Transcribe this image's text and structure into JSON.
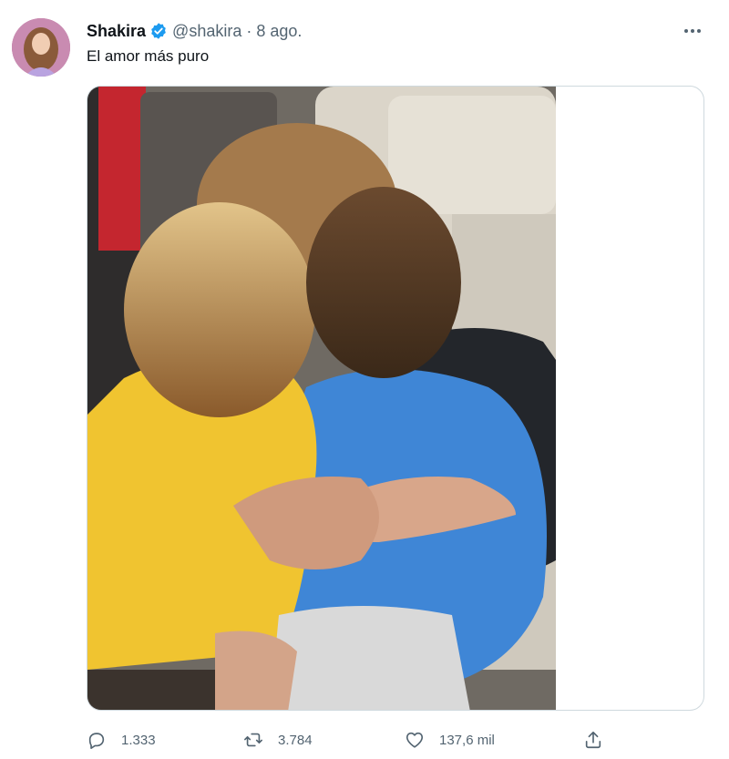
{
  "tweet": {
    "author": {
      "display_name": "Shakira",
      "handle": "@shakira",
      "verified": true,
      "avatar_icon": "profile-photo"
    },
    "time": "8 ago.",
    "separator": "·",
    "text": "El amor más puro",
    "media": {
      "kind": "photo"
    },
    "actions": {
      "reply": {
        "icon": "reply-icon",
        "count": "1.333"
      },
      "retweet": {
        "icon": "retweet-icon",
        "count": "3.784"
      },
      "like": {
        "icon": "heart-icon",
        "count": "137,6 mil"
      },
      "share": {
        "icon": "share-icon"
      }
    }
  },
  "colors": {
    "text": "#0f1419",
    "secondary": "#536471",
    "verified": "#1d9bf0",
    "border": "#cfd9de"
  }
}
